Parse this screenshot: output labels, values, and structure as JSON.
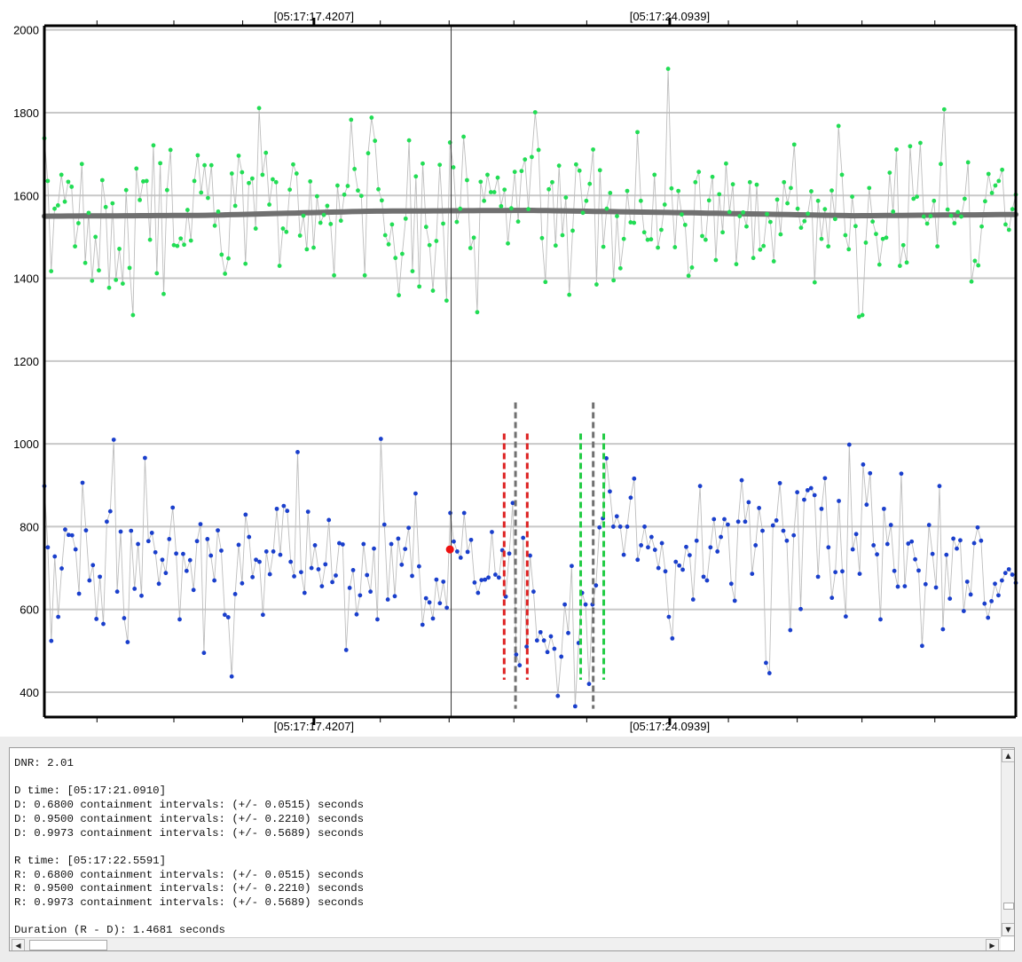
{
  "chart_data": {
    "type": "scatter",
    "title": "",
    "ylim": [
      340,
      2010
    ],
    "x_range_seconds": [
      0,
      24.0
    ],
    "yticks": [
      400,
      600,
      800,
      1000,
      1200,
      1400,
      1600,
      1800,
      2000
    ],
    "time_labels": [
      {
        "label": "[05:17:17.4207]",
        "x": 6.66
      },
      {
        "label": "[05:17:24.0939]",
        "x": 15.45
      }
    ],
    "minor_ticks_x": [
      1.3,
      3.2,
      4.9,
      8.3,
      10.0,
      11.6,
      13.4,
      16.9,
      18.6,
      20.2,
      22.0
    ],
    "cursor_x": 10.05,
    "grid": true,
    "series": [
      {
        "color": "#22dd55",
        "values": [
          1738,
          1635,
          1417,
          1568,
          1576,
          1650,
          1585,
          1633,
          1621,
          1477,
          1533,
          1676,
          1437,
          1558,
          1394,
          1500,
          1419,
          1637,
          1572,
          1377,
          1581,
          1396,
          1471,
          1387,
          1613,
          1425,
          1311,
          1665,
          1589,
          1634,
          1635,
          1493,
          1721,
          1412,
          1678,
          1362,
          1613,
          1710,
          1480,
          1478,
          1496,
          1481,
          1565,
          1491,
          1635,
          1697,
          1607,
          1673,
          1594,
          1673,
          1527,
          1561,
          1457,
          1411,
          1448,
          1653,
          1575,
          1696,
          1656,
          1435,
          1630,
          1641,
          1520,
          1811,
          1650,
          1703,
          1578,
          1639,
          1632,
          1430,
          1520,
          1512,
          1614,
          1675,
          1653,
          1503,
          1551,
          1470,
          1634,
          1474,
          1598,
          1534,
          1553,
          1575,
          1531,
          1407,
          1624,
          1539,
          1602,
          1623,
          1783,
          1664,
          1612,
          1599,
          1407,
          1702,
          1788,
          1732,
          1615,
          1588,
          1504,
          1482,
          1530,
          1449,
          1359,
          1459,
          1544,
          1733,
          1417,
          1646,
          1380,
          1677,
          1524,
          1480,
          1370,
          1490,
          1674,
          1532,
          1346,
          1728,
          1668,
          1536,
          1568,
          1742,
          1637,
          1473,
          1498,
          1318,
          1633,
          1587,
          1650,
          1608,
          1608,
          1643,
          1574,
          1614,
          1484,
          1569,
          1657,
          1537,
          1659,
          1687,
          1567,
          1693,
          1801,
          1710,
          1497,
          1391,
          1615,
          1632,
          1479,
          1672,
          1504,
          1595,
          1360,
          1515,
          1675,
          1660,
          1558,
          1587,
          1628,
          1711,
          1385,
          1661,
          1476,
          1568,
          1606,
          1395,
          1550,
          1424,
          1495,
          1611,
          1535,
          1534,
          1753,
          1587,
          1511,
          1493,
          1494,
          1650,
          1474,
          1517,
          1578,
          1906,
          1617,
          1475,
          1611,
          1554,
          1529,
          1406,
          1426,
          1632,
          1657,
          1502,
          1493,
          1588,
          1645,
          1444,
          1603,
          1511,
          1677,
          1560,
          1627,
          1434,
          1550,
          1559,
          1525,
          1632,
          1449,
          1626,
          1469,
          1478,
          1555,
          1536,
          1441,
          1590,
          1506,
          1632,
          1581,
          1618,
          1723,
          1568,
          1522,
          1538,
          1556,
          1610,
          1390,
          1587,
          1495,
          1567,
          1477,
          1612,
          1543,
          1768,
          1650,
          1504,
          1470,
          1597,
          1526,
          1307,
          1311,
          1486,
          1618,
          1537,
          1507,
          1433,
          1495,
          1498,
          1655,
          1561,
          1711,
          1430,
          1480,
          1438,
          1719,
          1592,
          1597,
          1727,
          1549,
          1532,
          1550,
          1587,
          1477,
          1676,
          1808,
          1566,
          1551,
          1533,
          1560,
          1549,
          1592,
          1680,
          1392,
          1442,
          1431,
          1525,
          1586,
          1652,
          1606,
          1624,
          1635,
          1662,
          1530,
          1517,
          1567,
          1602
        ]
      },
      {
        "color": "#1a3fcc",
        "values": [
          898,
          750,
          524,
          728,
          582,
          699,
          793,
          780,
          779,
          745,
          638,
          906,
          791,
          670,
          707,
          577,
          679,
          565,
          812,
          837,
          1010,
          643,
          788,
          579,
          521,
          790,
          650,
          758,
          633,
          966,
          765,
          785,
          738,
          662,
          720,
          688,
          770,
          846,
          735,
          576,
          734,
          693,
          719,
          647,
          765,
          806,
          495,
          770,
          730,
          670,
          791,
          742,
          587,
          581,
          438,
          637,
          756,
          663,
          829,
          775,
          678,
          720,
          715,
          587,
          740,
          685,
          740,
          843,
          732,
          850,
          838,
          715,
          680,
          980,
          690,
          640,
          836,
          700,
          755,
          697,
          656,
          709,
          816,
          666,
          682,
          760,
          757,
          502,
          652,
          695,
          588,
          634,
          758,
          683,
          643,
          747,
          576,
          1012,
          805,
          624,
          758,
          632,
          771,
          708,
          746,
          797,
          681,
          880,
          704,
          563,
          627,
          617,
          578,
          672,
          615,
          667,
          604,
          833,
          764,
          740,
          725,
          833,
          739,
          768,
          665,
          640,
          671,
          672,
          677,
          787,
          684,
          677,
          743,
          631,
          735
        ]
      },
      {
        "color": "#1a3fcc",
        "values": [
          857,
          491,
          465,
          773,
          510,
          730,
          643,
          525,
          545,
          525,
          497,
          535,
          505,
          391,
          486,
          612,
          543,
          705,
          366,
          519,
          640,
          612,
          420,
          612,
          658,
          798,
          820,
          965,
          885,
          800,
          825,
          800,
          732,
          800,
          870,
          916,
          720,
          755,
          800,
          750,
          775,
          744,
          700,
          760,
          692,
          582,
          530,
          715,
          706,
          696,
          751,
          731,
          624,
          766,
          898,
          679,
          670,
          750,
          818,
          740,
          775,
          818,
          805,
          662,
          621,
          812,
          912,
          812,
          859,
          686,
          755,
          845,
          790,
          471,
          446,
          803,
          815,
          905,
          790,
          766,
          550,
          779,
          883,
          601,
          865,
          888,
          893,
          876,
          679,
          843,
          917,
          750,
          628,
          690,
          862,
          692,
          583,
          998,
          745,
          782,
          686,
          950,
          853,
          929,
          755,
          733,
          576,
          843,
          758,
          804,
          693,
          655,
          928,
          656,
          759,
          764,
          721,
          694,
          512,
          661,
          804,
          734,
          653,
          898,
          552,
          732,
          626,
          771,
          747,
          767,
          596,
          667,
          636,
          760,
          798,
          766,
          614,
          580,
          620,
          662,
          634,
          670,
          688,
          697,
          684,
          664
        ]
      }
    ],
    "trend_line": {
      "color": "#707070",
      "x": [
        0,
        4,
        8,
        12,
        16,
        20,
        24
      ],
      "y": [
        1550,
        1552,
        1562,
        1564,
        1558,
        1551,
        1554
      ]
    },
    "marker_D": {
      "x": 10.02,
      "y": 745,
      "color": "#ee1111"
    },
    "vertical_markers": [
      {
        "x": 11.36,
        "color": "#dd2222",
        "style": "dashed",
        "ylim": [
          430,
          1025
        ]
      },
      {
        "x": 11.64,
        "color": "#707070",
        "style": "dashed",
        "ylim": [
          360,
          1100
        ]
      },
      {
        "x": 11.93,
        "color": "#dd2222",
        "style": "dashed",
        "ylim": [
          430,
          1025
        ]
      },
      {
        "x": 13.25,
        "color": "#22cc44",
        "style": "dashed",
        "ylim": [
          430,
          1025
        ]
      },
      {
        "x": 13.56,
        "color": "#707070",
        "style": "dashed",
        "ylim": [
          360,
          1100
        ]
      },
      {
        "x": 13.82,
        "color": "#22cc44",
        "style": "dashed",
        "ylim": [
          430,
          1025
        ]
      }
    ]
  },
  "output": {
    "lines": [
      "DNR: 2.01",
      "",
      "D time: [05:17:21.0910]",
      "D: 0.6800 containment intervals: (+/- 0.0515) seconds",
      "D: 0.9500 containment intervals: (+/- 0.2210) seconds",
      "D: 0.9973 containment intervals: (+/- 0.5689) seconds",
      "",
      "R time: [05:17:22.5591]",
      "R: 0.6800 containment intervals: (+/- 0.0515) seconds",
      "R: 0.9500 containment intervals: (+/- 0.2210) seconds",
      "R: 0.9973 containment intervals: (+/- 0.5689) seconds",
      "",
      "Duration (R - D): 1.4681 seconds"
    ]
  },
  "scroll": {
    "up_arrow": "▲",
    "down_arrow": "▼",
    "left_arrow": "◀",
    "right_arrow": "▶"
  }
}
